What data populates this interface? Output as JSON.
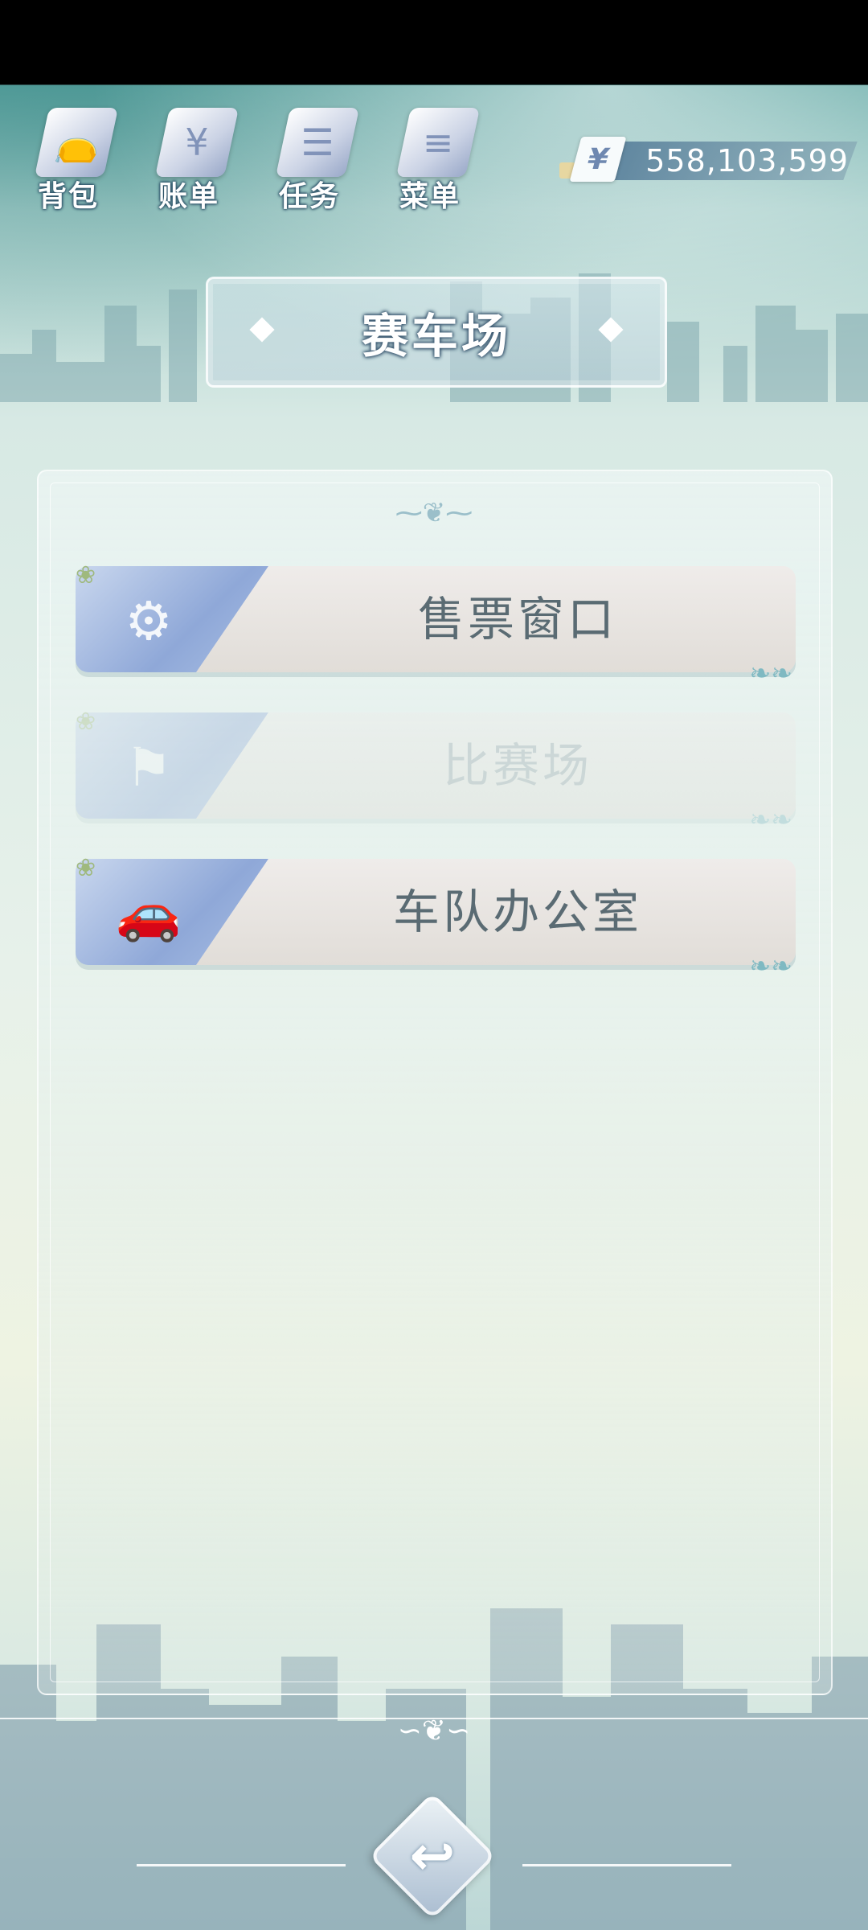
{
  "topbar": {
    "nav": [
      {
        "label": "背包",
        "icon": "bag-icon",
        "glyph": "👝"
      },
      {
        "label": "账单",
        "icon": "bill-icon",
        "glyph": "¥"
      },
      {
        "label": "任务",
        "icon": "task-icon",
        "glyph": "☰"
      },
      {
        "label": "菜单",
        "icon": "menu-icon",
        "glyph": "≡"
      }
    ],
    "currency": {
      "symbol": "¥",
      "amount": "558,103,599"
    }
  },
  "title": "赛车场",
  "menu": [
    {
      "label": "售票窗口",
      "icon": "wheel-icon",
      "glyph": "⚙",
      "enabled": true
    },
    {
      "label": "比赛场",
      "icon": "race-flag-icon",
      "glyph": "⚑",
      "enabled": false
    },
    {
      "label": "车队办公室",
      "icon": "cars-icon",
      "glyph": "🚗",
      "enabled": true
    }
  ],
  "back_button": {
    "icon": "return-arrow-icon",
    "glyph": "↩"
  },
  "colors": {
    "accent": "#8fa8d8",
    "label_text": "#5a6b73",
    "title_outline": "#3f5c74"
  }
}
